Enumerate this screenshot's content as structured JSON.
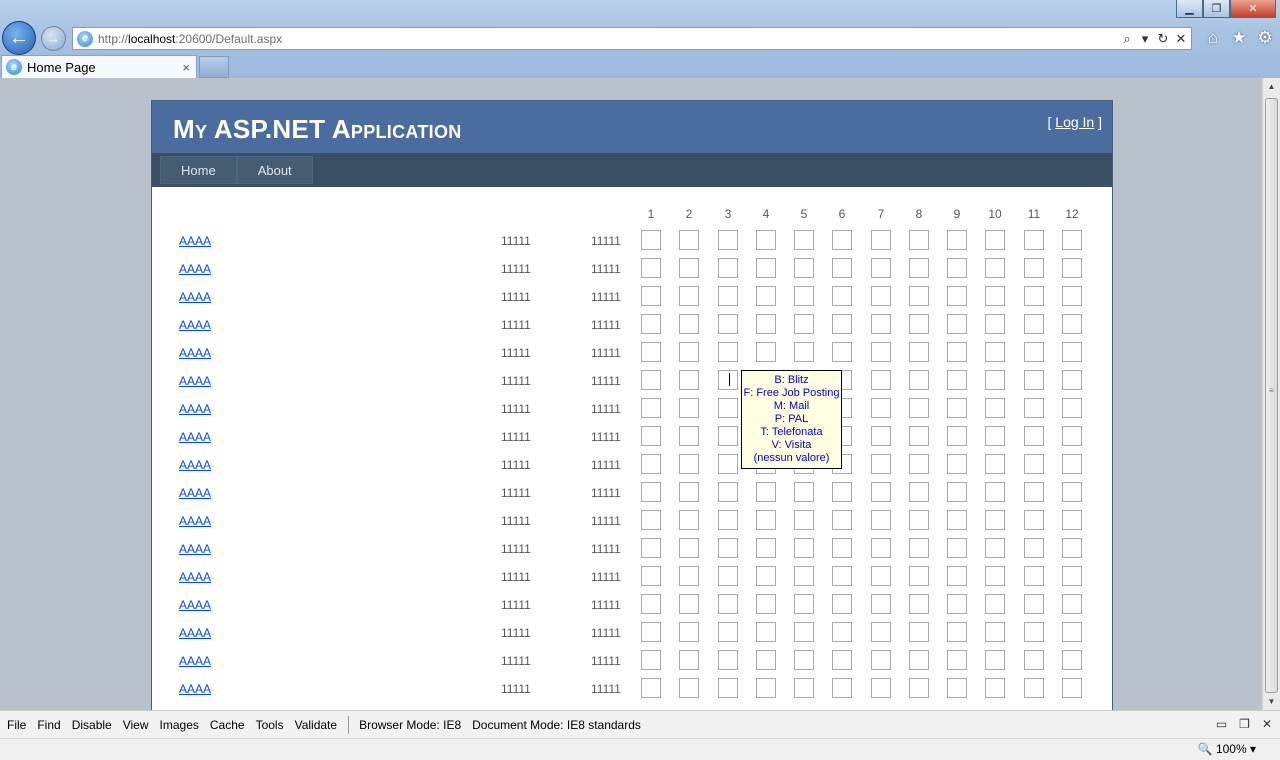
{
  "browser": {
    "url_prefix": "http://",
    "url_host": "localhost",
    "url_rest": ":20600/Default.aspx",
    "tab_title": "Home Page",
    "tab_close": "×"
  },
  "site": {
    "title": "My ASP.NET Application",
    "login_open": "[ ",
    "login_label": "Log In",
    "login_close": " ]",
    "menu": [
      "Home",
      "About"
    ]
  },
  "grid": {
    "column_headers": [
      "1",
      "2",
      "3",
      "4",
      "5",
      "6",
      "7",
      "8",
      "9",
      "10",
      "11",
      "12"
    ],
    "rows": [
      {
        "link": "AAAA",
        "v1": "11111",
        "v2": "11111"
      },
      {
        "link": "AAAA",
        "v1": "11111",
        "v2": "11111"
      },
      {
        "link": "AAAA",
        "v1": "11111",
        "v2": "11111"
      },
      {
        "link": "AAAA",
        "v1": "11111",
        "v2": "11111"
      },
      {
        "link": "AAAA",
        "v1": "11111",
        "v2": "11111"
      },
      {
        "link": "AAAA",
        "v1": "11111",
        "v2": "11111"
      },
      {
        "link": "AAAA",
        "v1": "11111",
        "v2": "11111"
      },
      {
        "link": "AAAA",
        "v1": "11111",
        "v2": "11111"
      },
      {
        "link": "AAAA",
        "v1": "11111",
        "v2": "11111"
      },
      {
        "link": "AAAA",
        "v1": "11111",
        "v2": "11111"
      },
      {
        "link": "AAAA",
        "v1": "11111",
        "v2": "11111"
      },
      {
        "link": "AAAA",
        "v1": "11111",
        "v2": "11111"
      },
      {
        "link": "AAAA",
        "v1": "11111",
        "v2": "11111"
      },
      {
        "link": "AAAA",
        "v1": "11111",
        "v2": "11111"
      },
      {
        "link": "AAAA",
        "v1": "11111",
        "v2": "11111"
      },
      {
        "link": "AAAA",
        "v1": "11111",
        "v2": "11111"
      },
      {
        "link": "AAAA",
        "v1": "11111",
        "v2": "11111"
      }
    ]
  },
  "tooltip": {
    "lines": [
      "B: Blitz",
      "F: Free Job Posting",
      "M: Mail",
      "P: PAL",
      "T: Telefonata",
      "V: Visita",
      "(nessun valore)"
    ]
  },
  "devbar": {
    "items": [
      "File",
      "Find",
      "Disable",
      "View",
      "Images",
      "Cache",
      "Tools",
      "Validate"
    ],
    "browser_mode_label": "Browser Mode:",
    "browser_mode_value": "IE8",
    "document_mode_label": "Document Mode:",
    "document_mode_value": "IE8 standards"
  },
  "status": {
    "zoom": "100%"
  },
  "icons": {
    "back": "back-arrow-icon",
    "forward": "forward-arrow-icon",
    "home": "home-icon",
    "favorites": "star-icon",
    "tools": "gear-icon"
  }
}
